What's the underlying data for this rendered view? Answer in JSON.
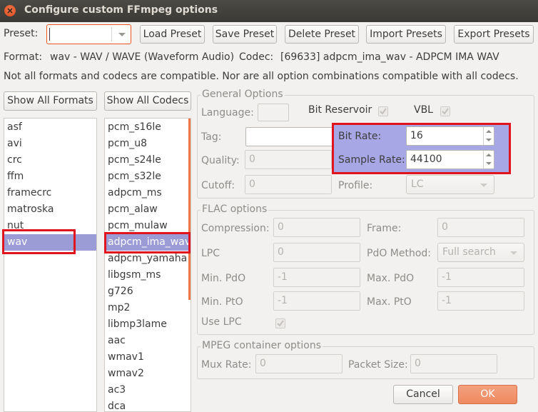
{
  "window": {
    "title": "Configure custom FFmpeg options"
  },
  "toolbar": {
    "preset_label": "Preset:",
    "preset_value": "",
    "load_preset": "Load Preset",
    "save_preset": "Save Preset",
    "delete_preset": "Delete Preset",
    "import_presets": "Import Presets",
    "export_presets": "Export Presets"
  },
  "info": {
    "format_label": "Format:",
    "format_value": "wav - WAV / WAVE (Waveform Audio)",
    "codec_label": "Codec:",
    "codec_value": "[69633] adpcm_ima_wav - ADPCM IMA WAV",
    "compat_note": "Not all formats and codecs are compatible. Nor are all option combinations compatible with all codecs."
  },
  "formats": {
    "show_all": "Show All Formats",
    "items": [
      "asf",
      "avi",
      "crc",
      "ffm",
      "framecrc",
      "matroska",
      "nut",
      "wav"
    ],
    "selected": "wav"
  },
  "codecs": {
    "show_all": "Show All Codecs",
    "items": [
      "pcm_s16le",
      "pcm_u8",
      "pcm_s24le",
      "pcm_s32le",
      "adpcm_ms",
      "pcm_alaw",
      "pcm_mulaw",
      "adpcm_ima_wav",
      "adpcm_yamaha",
      "libgsm_ms",
      "g726",
      "mp2",
      "libmp3lame",
      "aac",
      "wmav1",
      "wmav2",
      "ac3",
      "dca"
    ],
    "selected": "adpcm_ima_wav"
  },
  "general": {
    "title": "General Options",
    "language": "Language:",
    "bit_reservoir": "Bit Reservoir",
    "vbl": "VBL",
    "tag": "Tag:",
    "tag_value": "",
    "bit_rate": "Bit Rate:",
    "bit_rate_value": "16",
    "sample_rate": "Sample Rate:",
    "sample_rate_value": "44100",
    "quality": "Quality:",
    "quality_value": "0",
    "cutoff": "Cutoff:",
    "cutoff_value": "0",
    "profile": "Profile:",
    "profile_value": "LC"
  },
  "flac": {
    "title": "FLAC options",
    "compression": "Compression:",
    "compression_value": "0",
    "frame": "Frame:",
    "frame_value": "0",
    "lpc": "LPC",
    "lpc_value": "0",
    "pdo_method": "PdO Method:",
    "pdo_method_value": "Full search",
    "min_pdo": "Min. PdO",
    "min_pdo_value": "-1",
    "max_pdo": "Max. PdO",
    "max_pdo_value": "-1",
    "min_pto": "Min. PtO",
    "min_pto_value": "-1",
    "max_pto": "Max. PtO",
    "max_pto_value": "-1",
    "use_lpc": "Use LPC"
  },
  "mpeg": {
    "title": "MPEG container options",
    "mux_rate": "Mux Rate:",
    "mux_rate_value": "0",
    "packet_size": "Packet Size:",
    "packet_size_value": "0"
  },
  "buttons": {
    "cancel": "Cancel",
    "ok": "OK"
  },
  "colors": {
    "accent": "#e95420",
    "selection": "#9b9bd5",
    "highlight": "#a7a7e6",
    "annotation_red": "#e0141e"
  }
}
